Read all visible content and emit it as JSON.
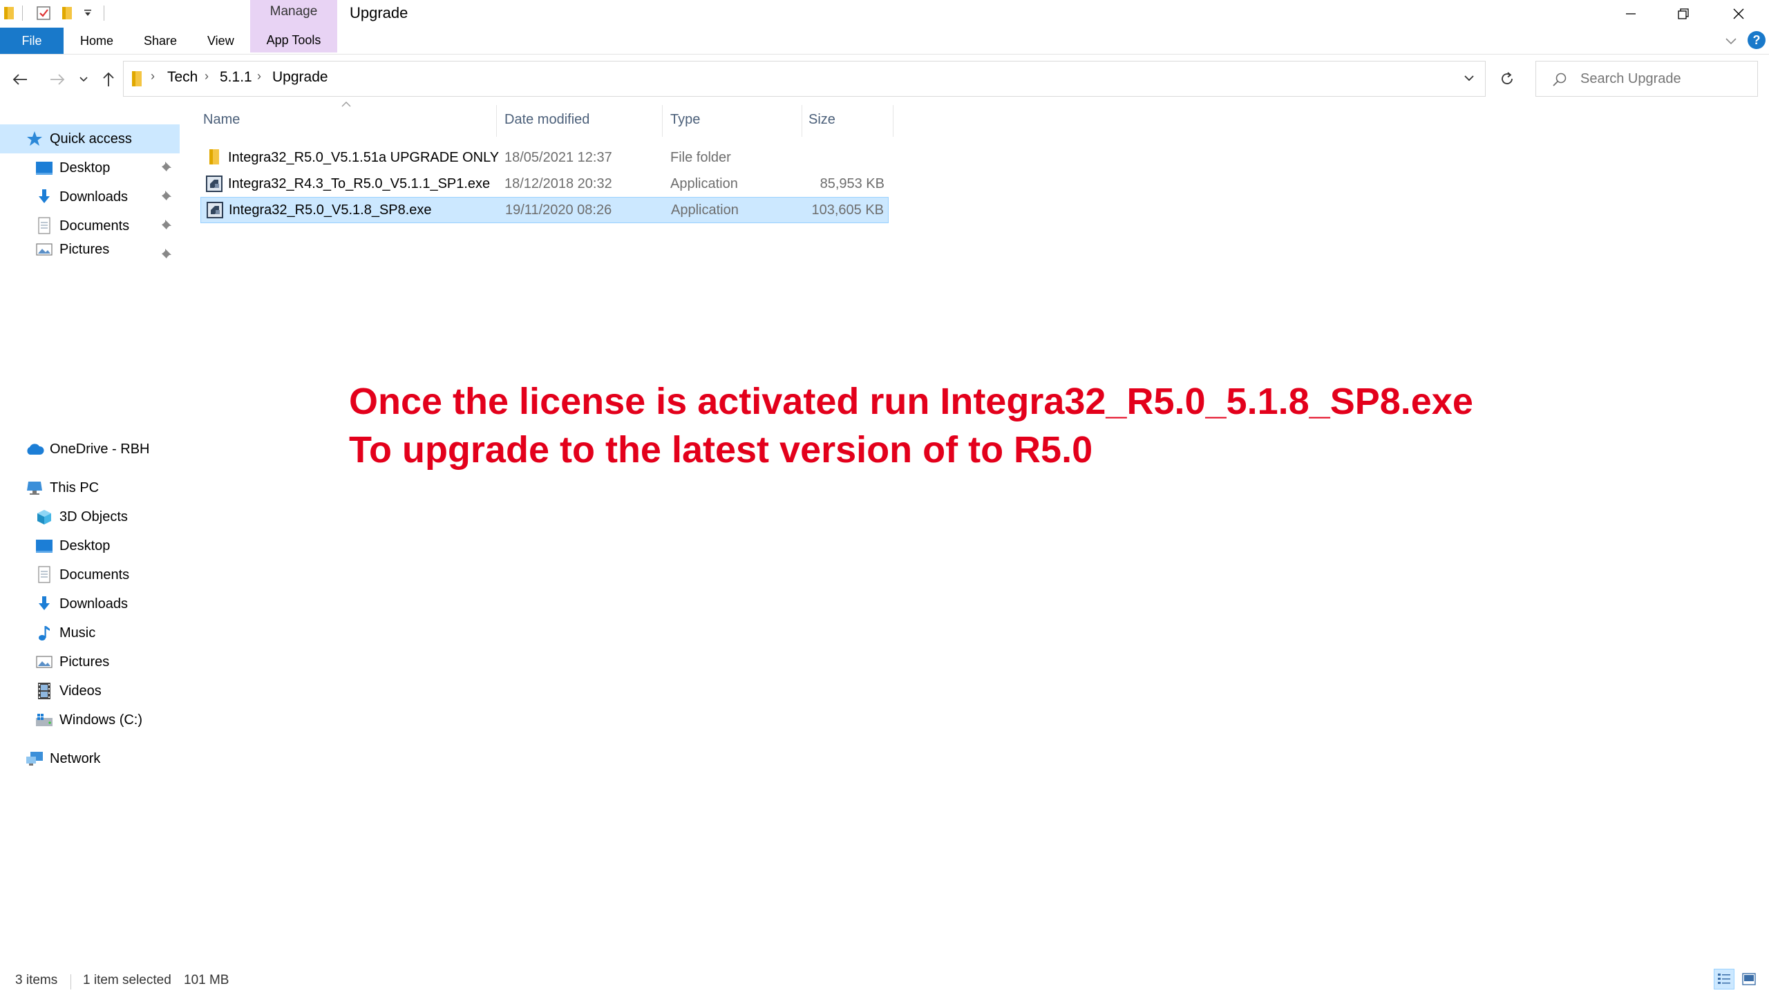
{
  "window": {
    "title": "Upgrade",
    "contextual_group": "Manage",
    "contextual_tab": "App Tools"
  },
  "ribbon": {
    "tabs": [
      "File",
      "Home",
      "Share",
      "View"
    ]
  },
  "address": {
    "crumbs": [
      "Tech",
      "5.1.1",
      "Upgrade"
    ]
  },
  "search": {
    "placeholder": "Search Upgrade"
  },
  "nav": {
    "quick_access": "Quick access",
    "quick_items": [
      "Desktop",
      "Downloads",
      "Documents",
      "Pictures"
    ],
    "onedrive": "OneDrive - RBH",
    "this_pc": "This PC",
    "pc_items": [
      "3D Objects",
      "Desktop",
      "Documents",
      "Downloads",
      "Music",
      "Pictures",
      "Videos",
      "Windows (C:)"
    ],
    "network": "Network"
  },
  "columns": {
    "name": "Name",
    "date": "Date modified",
    "type": "Type",
    "size": "Size"
  },
  "files": [
    {
      "name": "Integra32_R5.0_V5.1.51a UPGRADE ONLY",
      "date": "18/05/2021 12:37",
      "type": "File folder",
      "size": "",
      "icon": "folder-icon",
      "selected": false
    },
    {
      "name": "Integra32_R4.3_To_R5.0_V5.1.1_SP1.exe",
      "date": "18/12/2018 20:32",
      "type": "Application",
      "size": "85,953 KB",
      "icon": "application-icon",
      "selected": false
    },
    {
      "name": "Integra32_R5.0_V5.1.8_SP8.exe",
      "date": "19/11/2020 08:26",
      "type": "Application",
      "size": "103,605 KB",
      "icon": "application-icon",
      "selected": true
    }
  ],
  "annotation": {
    "line1": "Once the license is activated run Integra32_R5.0_5.1.8_SP8.exe",
    "line2": "To upgrade to the latest version of to R5.0"
  },
  "status": {
    "items": "3 items",
    "selected": "1 item selected",
    "size": "101 MB"
  },
  "colors": {
    "accent": "#1979ca",
    "selection": "#cce8ff",
    "manage_tab": "#e8d3f4",
    "annotation": "#e3001b"
  }
}
